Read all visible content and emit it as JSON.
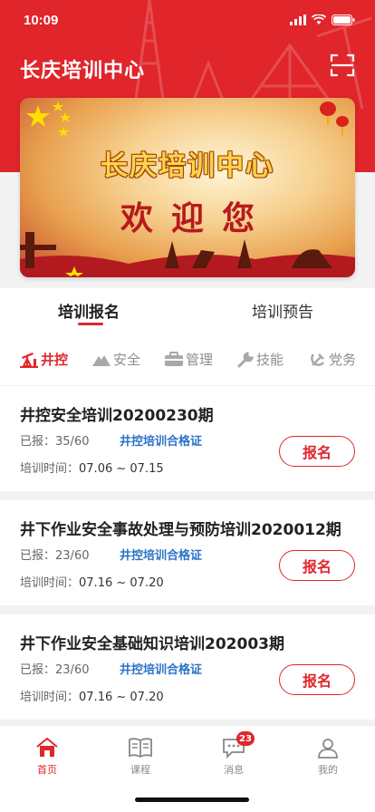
{
  "status": {
    "time": "10:09"
  },
  "header": {
    "title": "长庆培训中心"
  },
  "banner": {
    "title": "长庆培训中心",
    "subtitle": "欢迎您"
  },
  "tabs": [
    {
      "label": "培训报名",
      "active": true
    },
    {
      "label": "培训预告",
      "active": false
    }
  ],
  "categories": [
    {
      "label": "井控",
      "icon": "oil-pump-icon",
      "active": true
    },
    {
      "label": "安全",
      "icon": "mountain-icon",
      "active": false
    },
    {
      "label": "管理",
      "icon": "briefcase-icon",
      "active": false
    },
    {
      "label": "技能",
      "icon": "wrench-icon",
      "active": false
    },
    {
      "label": "党务",
      "icon": "hammer-sickle-icon",
      "active": false
    }
  ],
  "trainings": [
    {
      "title": "井控安全培训20200230期",
      "enrolled_label": "已报：",
      "enrolled": "35/60",
      "cert": "井控培训合格证",
      "time_label": "培训时间：",
      "time": "07.06 ~ 07.15",
      "button": "报名"
    },
    {
      "title": "井下作业安全事故处理与预防培训2020012期",
      "enrolled_label": "已报：",
      "enrolled": "23/60",
      "cert": "井控培训合格证",
      "time_label": "培训时间：",
      "time": "07.16 ~ 07.20",
      "button": "报名"
    },
    {
      "title": "井下作业安全基础知识培训202003期",
      "enrolled_label": "已报：",
      "enrolled": "23/60",
      "cert": "井控培训合格证",
      "time_label": "培训时间：",
      "time": "07.16 ~ 07.20",
      "button": "报名"
    }
  ],
  "bottom_nav": [
    {
      "label": "首页",
      "icon": "home-icon",
      "active": true
    },
    {
      "label": "课程",
      "icon": "book-icon",
      "active": false
    },
    {
      "label": "消息",
      "icon": "message-icon",
      "active": false,
      "badge": "23"
    },
    {
      "label": "我的",
      "icon": "user-icon",
      "active": false
    }
  ],
  "colors": {
    "brand_red": "#e0262c",
    "link_blue": "#2b72c6"
  }
}
